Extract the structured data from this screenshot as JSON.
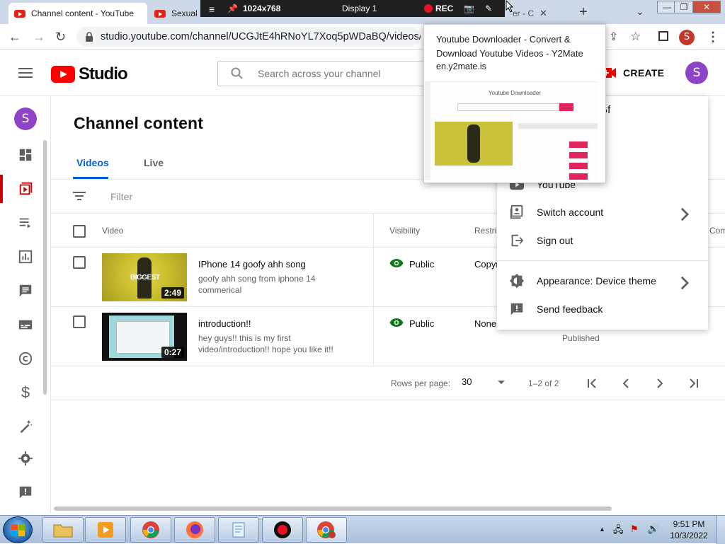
{
  "browser": {
    "tabs": [
      {
        "title": "Channel content - YouTube"
      },
      {
        "title": "Sexual"
      },
      {
        "title": "er - C"
      }
    ],
    "recorder": {
      "resolution": "1024x768",
      "display": "Display 1",
      "rec_label": "REC"
    },
    "url": "studio.youtube.com/channel/UCGJtE4hRNoYL7Xoq5pWDaBQ/videos/uplo",
    "profile_initial": "S"
  },
  "header": {
    "logo_text": "Studio",
    "search_placeholder": "Search across your channel",
    "create_label": "CREATE",
    "avatar_initial": "S"
  },
  "sidebar": {
    "avatar_initial": "S",
    "items": [
      {
        "icon": "dashboard-icon"
      },
      {
        "icon": "content-icon",
        "active": true
      },
      {
        "icon": "playlists-icon"
      },
      {
        "icon": "analytics-icon"
      },
      {
        "icon": "comments-icon"
      },
      {
        "icon": "subtitles-icon"
      },
      {
        "icon": "copyright-icon"
      },
      {
        "icon": "earn-icon"
      },
      {
        "icon": "customization-icon"
      },
      {
        "icon": "settings-icon"
      },
      {
        "icon": "feedback-icon"
      }
    ]
  },
  "page": {
    "title": "Channel content",
    "tabs": [
      {
        "label": "Videos",
        "active": true
      },
      {
        "label": "Live"
      }
    ],
    "filter_label": "Filter"
  },
  "table": {
    "headers": {
      "video": "Video",
      "visibility": "Visibility",
      "restrictions": "Restri",
      "comments": "Com"
    },
    "rows": [
      {
        "title": "IPhone 14 goofy ahh song",
        "description": "goofy ahh song from iphone 14 commerical",
        "duration": "2:49",
        "visibility": "Public",
        "restrictions": "Copyr"
      },
      {
        "title": "introduction!!",
        "description": "hey guys!! this is my first video/introduction!! hope you like it!!",
        "duration": "0:27",
        "visibility": "Public",
        "restrictions": "None",
        "date_status": "Published"
      }
    ],
    "pagination": {
      "rows_per_page_label": "Rows per page:",
      "rows_per_page": "30",
      "range": "1–2 of 2"
    }
  },
  "account_menu": {
    "name_partial": "n Gf",
    "items": [
      {
        "label": "YouTube"
      },
      {
        "label": "Switch account",
        "has_submenu": true
      },
      {
        "label": "Sign out"
      },
      {
        "label": "Appearance: Device theme",
        "has_submenu": true
      },
      {
        "label": "Send feedback"
      }
    ]
  },
  "popup": {
    "title": "Youtube Downloader - Convert & Download Youtube Videos - Y2Mate",
    "domain": "en.y2mate.is",
    "preview_heading": "Youtube Downloader"
  },
  "taskbar": {
    "time": "9:51 PM",
    "date": "10/3/2022"
  },
  "colors": {
    "youtube_red": "#ff0000",
    "accent_blue": "#065fd4",
    "avatar_purple": "#8e44c6",
    "public_green": "#107516"
  }
}
